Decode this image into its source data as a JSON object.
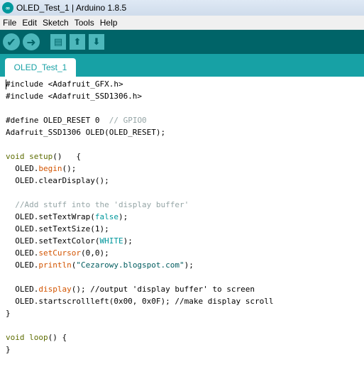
{
  "window": {
    "title": "OLED_Test_1 | Arduino 1.8.5",
    "logo_text": "∞"
  },
  "menu": {
    "items": [
      "File",
      "Edit",
      "Sketch",
      "Tools",
      "Help"
    ]
  },
  "toolbar": {
    "buttons": [
      {
        "name": "verify-button",
        "icon": "check-icon",
        "glyph": "✔"
      },
      {
        "name": "upload-button",
        "icon": "arrow-right-icon",
        "glyph": "➜"
      },
      {
        "name": "new-button",
        "icon": "new-file-icon",
        "glyph": "▤"
      },
      {
        "name": "open-button",
        "icon": "arrow-up-icon",
        "glyph": "⬆"
      },
      {
        "name": "save-button",
        "icon": "arrow-down-icon",
        "glyph": "⬇"
      }
    ]
  },
  "tabs": [
    {
      "label": "OLED_Test_1",
      "active": true
    }
  ],
  "code_lines": [
    [
      {
        "t": "#include <Adafruit_GFX.h>",
        "c": ""
      }
    ],
    [
      {
        "t": "#include <Adafruit_SSD1306.h>",
        "c": ""
      }
    ],
    [
      {
        "t": "",
        "c": ""
      }
    ],
    [
      {
        "t": "#define OLED_RESET 0  ",
        "c": ""
      },
      {
        "t": "// GPIO0",
        "c": "com"
      }
    ],
    [
      {
        "t": "Adafruit_SSD1306 OLED(OLED_RESET);",
        "c": ""
      }
    ],
    [
      {
        "t": "",
        "c": ""
      }
    ],
    [
      {
        "t": "void",
        "c": "kw"
      },
      {
        "t": " ",
        "c": ""
      },
      {
        "t": "setup",
        "c": "kw"
      },
      {
        "t": "()   {",
        "c": ""
      }
    ],
    [
      {
        "t": "  OLED.",
        "c": ""
      },
      {
        "t": "begin",
        "c": "fn"
      },
      {
        "t": "();",
        "c": ""
      }
    ],
    [
      {
        "t": "  OLED.clearDisplay();",
        "c": ""
      }
    ],
    [
      {
        "t": "",
        "c": ""
      }
    ],
    [
      {
        "t": "  //Add stuff into the 'display buffer'",
        "c": "com"
      }
    ],
    [
      {
        "t": "  OLED.setTextWrap(",
        "c": ""
      },
      {
        "t": "false",
        "c": "type"
      },
      {
        "t": ");",
        "c": ""
      }
    ],
    [
      {
        "t": "  OLED.setTextSize(1);",
        "c": ""
      }
    ],
    [
      {
        "t": "  OLED.setTextColor(",
        "c": ""
      },
      {
        "t": "WHITE",
        "c": "type"
      },
      {
        "t": ");",
        "c": ""
      }
    ],
    [
      {
        "t": "  OLED.",
        "c": ""
      },
      {
        "t": "setCursor",
        "c": "fn"
      },
      {
        "t": "(0,0);",
        "c": ""
      }
    ],
    [
      {
        "t": "  OLED.",
        "c": ""
      },
      {
        "t": "println",
        "c": "fn"
      },
      {
        "t": "(",
        "c": ""
      },
      {
        "t": "\"Cezarowy.blogspot.com\"",
        "c": "str"
      },
      {
        "t": ");",
        "c": ""
      }
    ],
    [
      {
        "t": "",
        "c": ""
      }
    ],
    [
      {
        "t": "  OLED.",
        "c": ""
      },
      {
        "t": "display",
        "c": "fn"
      },
      {
        "t": "(); //output 'display buffer' to screen",
        "c": ""
      }
    ],
    [
      {
        "t": "  OLED.startscrollleft(0x00, 0x0F); //make display scroll",
        "c": ""
      }
    ],
    [
      {
        "t": "}",
        "c": ""
      }
    ],
    [
      {
        "t": "",
        "c": ""
      }
    ],
    [
      {
        "t": "void",
        "c": "kw"
      },
      {
        "t": " ",
        "c": ""
      },
      {
        "t": "loop",
        "c": "kw"
      },
      {
        "t": "() {",
        "c": ""
      }
    ],
    [
      {
        "t": "}",
        "c": ""
      }
    ]
  ]
}
